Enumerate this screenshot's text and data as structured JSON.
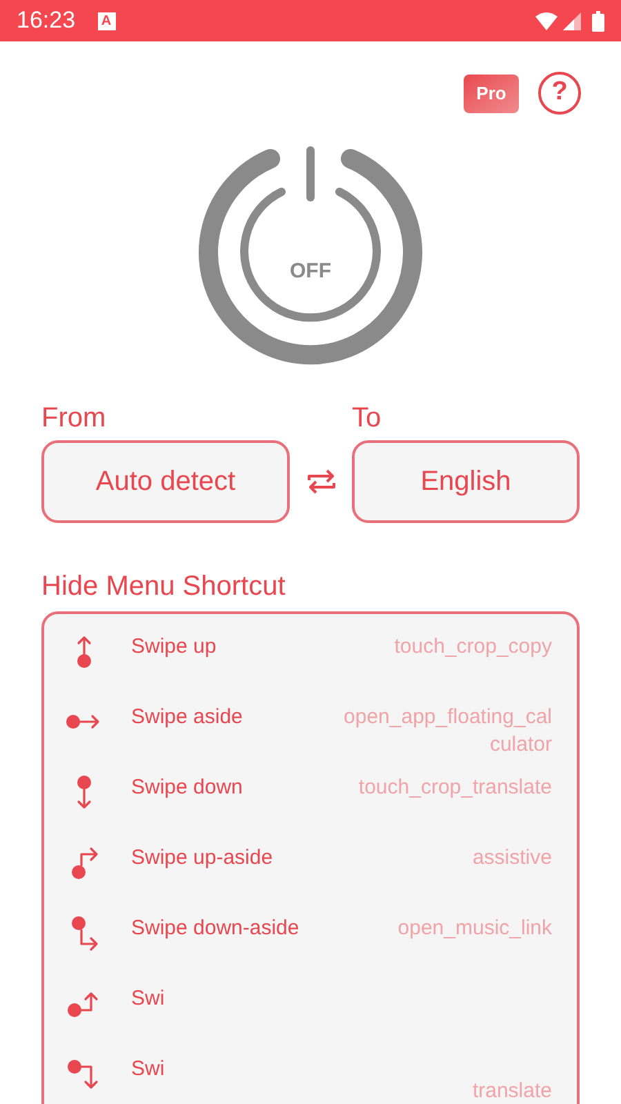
{
  "status_bar": {
    "time": "16:23",
    "notification": "A"
  },
  "header": {
    "pro": "Pro",
    "help": "?"
  },
  "power": {
    "on": false,
    "label": "OFF"
  },
  "languages": {
    "from_label": "From",
    "from": "Auto detect",
    "to_label": "To",
    "to": "English"
  },
  "shortcuts": {
    "title": "Hide Menu Shortcut",
    "items": [
      {
        "kind": "up",
        "label": "Swipe up",
        "action": "touch_crop_copy"
      },
      {
        "kind": "aside",
        "label": "Swipe aside",
        "action": "open_app_floating_calculator"
      },
      {
        "kind": "down",
        "label": "Swipe down",
        "action": "touch_crop_translate"
      },
      {
        "kind": "up_aside",
        "label": "Swipe up-aside",
        "action": "assistive"
      },
      {
        "kind": "down_aside",
        "label": "Swipe down-aside",
        "action": "open_music_link"
      },
      {
        "kind": "aside_up",
        "label": "Swi"
      },
      {
        "kind": "aside_down",
        "label": "Swi",
        "action": "translate"
      }
    ]
  }
}
